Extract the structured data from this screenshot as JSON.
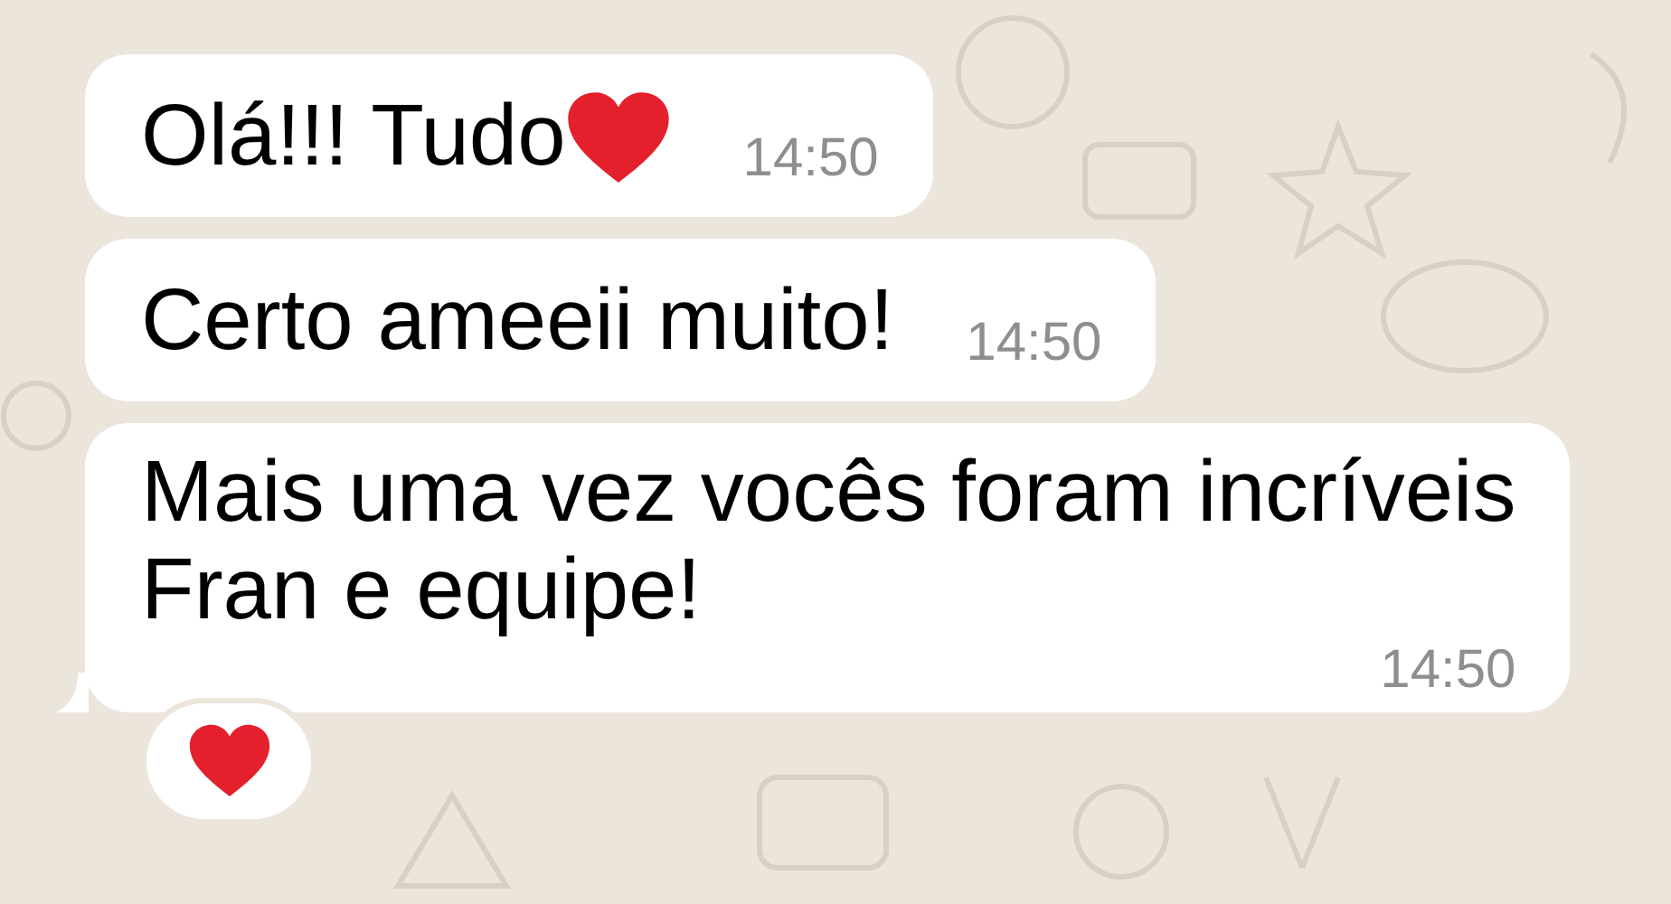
{
  "messages": [
    {
      "lines": [
        "Olá!!! Tudo"
      ],
      "trailing_heart": true,
      "time": "14:50",
      "tail": false
    },
    {
      "lines": [
        "Certo ameeii muito!"
      ],
      "trailing_heart": false,
      "time": "14:50",
      "tail": false
    },
    {
      "lines": [
        "Mais uma vez vocês foram incríveis",
        "Fran e equipe!"
      ],
      "trailing_heart": false,
      "time": "14:50",
      "tail": true,
      "reaction": {
        "kind": "heart"
      }
    }
  ]
}
